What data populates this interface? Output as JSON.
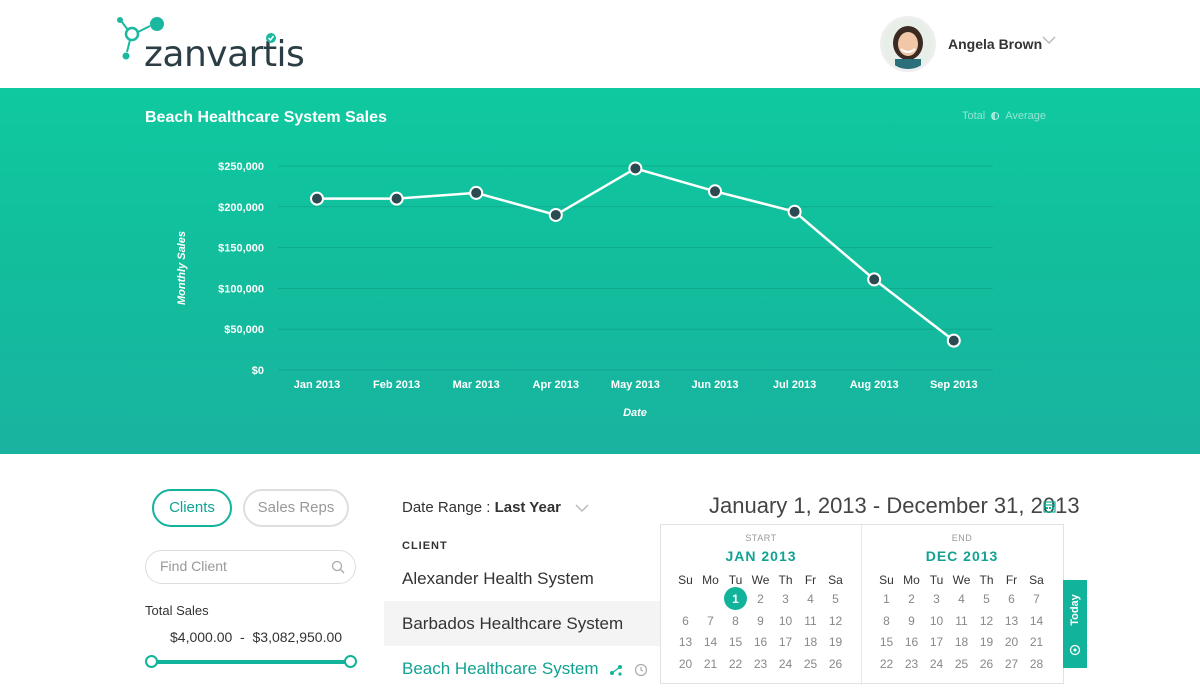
{
  "app": {
    "logo_text": "zanvartis",
    "user_name": "Angela Brown"
  },
  "chart_header": {
    "title": "Beach Healthcare System Sales",
    "legend_total": "Total",
    "legend_average": "Average"
  },
  "chart_data": {
    "type": "line",
    "title": "Beach Healthcare System Sales",
    "xlabel": "Date",
    "ylabel": "Monthly Sales",
    "categories": [
      "Jan 2013",
      "Feb 2013",
      "Mar 2013",
      "Apr 2013",
      "May 2013",
      "Jun 2013",
      "Jul 2013",
      "Aug 2013",
      "Sep 2013"
    ],
    "values": [
      210000,
      210000,
      217000,
      190000,
      247000,
      219000,
      194000,
      111000,
      36000
    ],
    "y_ticks": [
      0,
      50000,
      100000,
      150000,
      200000,
      250000
    ],
    "y_tick_labels": [
      "$0",
      "$50,000",
      "$100,000",
      "$150,000",
      "$200,000",
      "$250,000"
    ],
    "ylim": [
      0,
      250000
    ],
    "grid": true,
    "line_color": "#ffffff",
    "marker_color": "#2c4a52"
  },
  "tabs": {
    "clients": "Clients",
    "sales_reps": "Sales Reps"
  },
  "search": {
    "placeholder": "Find Client"
  },
  "filters": {
    "total_sales_label": "Total Sales",
    "total_sales_range": "$4,000.00  -  $3,082,950.00",
    "slider_min_fraction": 0,
    "slider_max_fraction": 1
  },
  "date_range": {
    "label": "Date Range :",
    "value": "Last Year"
  },
  "clients": {
    "header": "CLIENT",
    "items": [
      "Alexander Health System",
      "Barbados Healthcare System",
      "Beach Healthcare System"
    ]
  },
  "calendar": {
    "range_text": "January 1, 2013 - December 31, 2013",
    "start_caption": "START",
    "end_caption": "END",
    "start_month": "JAN  2013",
    "end_month": "DEC  2013",
    "weekdays": [
      "Su",
      "Mo",
      "Tu",
      "We",
      "Th",
      "Fr",
      "Sa"
    ],
    "start_days": [
      [
        "",
        "",
        "1",
        "2",
        "3",
        "4",
        "5"
      ],
      [
        "6",
        "7",
        "8",
        "9",
        "10",
        "11",
        "12"
      ],
      [
        "13",
        "14",
        "15",
        "16",
        "17",
        "18",
        "19"
      ],
      [
        "20",
        "21",
        "22",
        "23",
        "24",
        "25",
        "26"
      ]
    ],
    "end_days": [
      [
        "1",
        "2",
        "3",
        "4",
        "5",
        "6",
        "7"
      ],
      [
        "8",
        "9",
        "10",
        "11",
        "12",
        "13",
        "14"
      ],
      [
        "15",
        "16",
        "17",
        "18",
        "19",
        "20",
        "21"
      ],
      [
        "22",
        "23",
        "24",
        "25",
        "26",
        "27",
        "28"
      ]
    ],
    "selected_start_day": "1",
    "today_label": "Today"
  },
  "colors": {
    "accent": "#12b39b",
    "band_top": "#0fc9a0",
    "band_bottom": "#19b3a0"
  }
}
